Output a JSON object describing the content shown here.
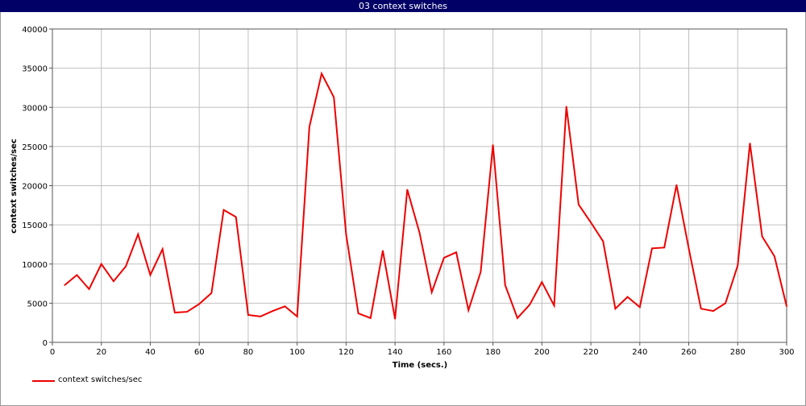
{
  "window": {
    "title": "03 context switches"
  },
  "colors": {
    "titlebar": "#000066",
    "series": "#ee0000",
    "grid": "#c0c0c0"
  },
  "chart_data": {
    "type": "line",
    "xlabel": "Time (secs.)",
    "ylabel": "context switches/sec",
    "xlim": [
      0,
      300
    ],
    "ylim": [
      0,
      40000
    ],
    "xticks": [
      0,
      20,
      40,
      60,
      80,
      100,
      120,
      140,
      160,
      180,
      200,
      220,
      240,
      260,
      280,
      300
    ],
    "yticks": [
      0,
      5000,
      10000,
      15000,
      20000,
      25000,
      30000,
      35000,
      40000
    ],
    "grid": true,
    "legend_position": "bottom-left",
    "series": [
      {
        "name": "context switches/sec",
        "color": "#ee0000",
        "x": [
          5,
          10,
          15,
          20,
          25,
          30,
          35,
          40,
          45,
          50,
          55,
          60,
          65,
          70,
          75,
          80,
          85,
          90,
          95,
          100,
          105,
          110,
          115,
          120,
          125,
          130,
          135,
          140,
          145,
          150,
          155,
          160,
          165,
          170,
          175,
          180,
          185,
          190,
          195,
          200,
          205,
          210,
          215,
          220,
          225,
          230,
          235,
          240,
          245,
          250,
          255,
          260,
          265,
          270,
          275,
          280,
          285,
          290,
          295,
          300
        ],
        "y": [
          7300,
          8600,
          6800,
          10000,
          7800,
          9700,
          13800,
          8600,
          11900,
          3800,
          3900,
          4900,
          6300,
          16900,
          16000,
          3500,
          3300,
          4000,
          4600,
          3300,
          27500,
          34300,
          31300,
          13800,
          3700,
          3100,
          11700,
          3000,
          19500,
          14000,
          6400,
          10800,
          11500,
          4100,
          9000,
          25200,
          7300,
          3100,
          4800,
          7700,
          4700,
          30100,
          17600,
          15300,
          12900,
          4300,
          5800,
          4500,
          12000,
          12100,
          20100,
          12000,
          4300,
          4000,
          5000,
          9800,
          25400,
          13500,
          11000,
          4600
        ]
      }
    ]
  }
}
